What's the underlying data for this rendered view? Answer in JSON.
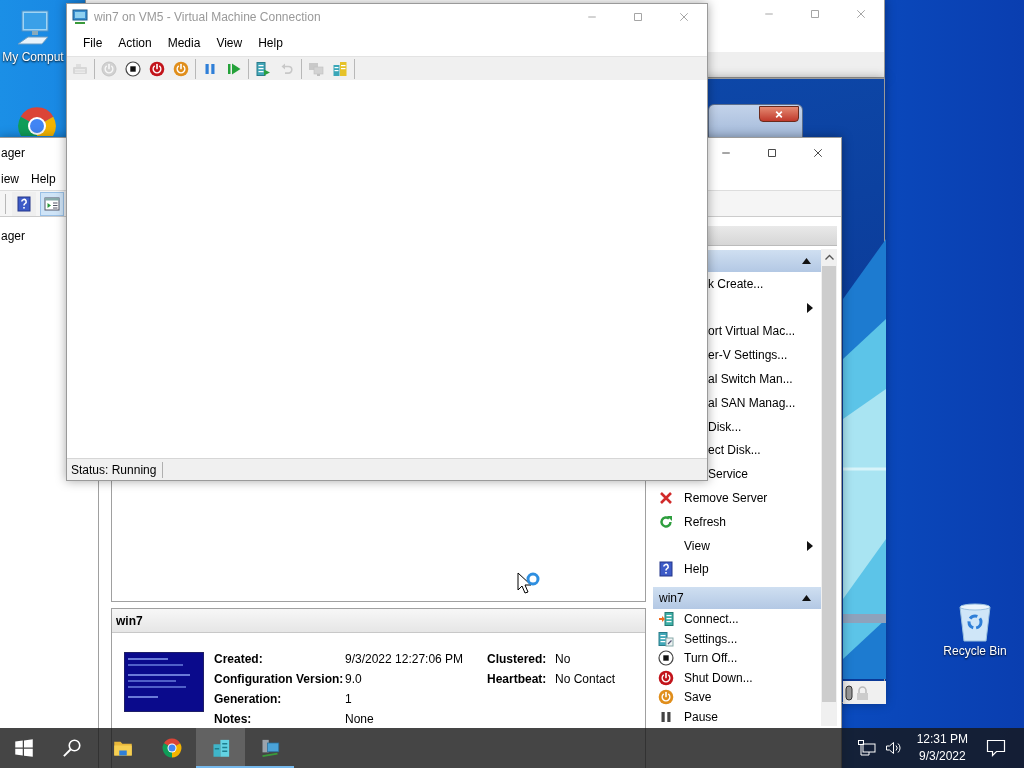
{
  "desktop_icons": [
    {
      "kind": "computer",
      "label": "My Comput"
    },
    {
      "kind": "chrome"
    },
    {
      "kind": "recycle-bin",
      "label": "Recycle Bin"
    }
  ],
  "vm_connection": {
    "title": "win7 on VM5 - Virtual Machine Connection",
    "menu": [
      "File",
      "Action",
      "Media",
      "View",
      "Help"
    ],
    "toolbar": [
      [
        {
          "kind": "ctrl-alt-del",
          "disabled": true
        }
      ],
      [
        {
          "kind": "start",
          "disabled": true
        },
        {
          "kind": "turn-off",
          "disabled": false
        },
        {
          "kind": "shut-down",
          "disabled": false
        },
        {
          "kind": "save",
          "disabled": false
        }
      ],
      [
        {
          "kind": "pause",
          "disabled": false
        },
        {
          "kind": "reset",
          "disabled": false
        }
      ],
      [
        {
          "kind": "checkpoint",
          "disabled": false
        },
        {
          "kind": "revert",
          "disabled": true
        }
      ],
      [
        {
          "kind": "enhanced-session",
          "disabled": true
        },
        {
          "kind": "zoom",
          "disabled": false
        }
      ]
    ],
    "status": "Status: Running"
  },
  "hyperv_manager": {
    "title": "ager",
    "menu": [
      "iew",
      "Help"
    ],
    "toolbar": [
      {
        "kind": "help",
        "on": false
      },
      {
        "kind": "show-pane",
        "on": true
      }
    ],
    "tree": [
      "ager"
    ],
    "details": {
      "title": "win7",
      "fields": [
        {
          "label": "Created:",
          "value": "9/3/2022 12:27:06 PM"
        },
        {
          "label": "Configuration Version:",
          "value": "9.0"
        },
        {
          "label": "Generation:",
          "value": "1"
        },
        {
          "label": "Notes:",
          "value": "None"
        }
      ],
      "fields_right": [
        {
          "label": "Clustered:",
          "value": "No"
        },
        {
          "label": "Heartbeat:",
          "value": "No Contact"
        }
      ]
    },
    "actions": [
      {
        "expanded": true,
        "items": [
          {
            "kind": "clipped",
            "label": "k Create...",
            "submenu": false
          },
          {
            "kind": "clipped",
            "submenu": true
          },
          {
            "kind": "clipped",
            "label": "ort Virtual Mac...",
            "submenu": false
          },
          {
            "kind": "clipped",
            "label": "er-V Settings...",
            "submenu": false
          },
          {
            "kind": "clipped",
            "label": "al Switch Man...",
            "submenu": false
          },
          {
            "kind": "clipped",
            "label": "al SAN Manag...",
            "submenu": false
          },
          {
            "kind": "clipped",
            "label": "Disk...",
            "submenu": false
          },
          {
            "kind": "clipped",
            "label": "ect Disk...",
            "submenu": false
          },
          {
            "kind": "clipped",
            "label": "Service",
            "submenu": false
          },
          {
            "kind": "remove",
            "label": "Remove Server",
            "submenu": false
          },
          {
            "kind": "refresh",
            "label": "Refresh",
            "submenu": false
          },
          {
            "kind": "plain",
            "label": "View",
            "submenu": true
          },
          {
            "kind": "help",
            "label": "Help",
            "submenu": false
          }
        ]
      },
      {
        "title": "win7",
        "expanded": true,
        "items": [
          {
            "kind": "connect",
            "label": "Connect...",
            "submenu": false
          },
          {
            "kind": "settings",
            "label": "Settings...",
            "submenu": false
          },
          {
            "kind": "turn-off",
            "label": "Turn Off...",
            "submenu": false
          },
          {
            "kind": "shut-down",
            "label": "Shut Down...",
            "submenu": false
          },
          {
            "kind": "save",
            "label": "Save",
            "submenu": false
          },
          {
            "kind": "pause",
            "label": "Pause",
            "submenu": false
          }
        ]
      }
    ]
  },
  "taskbar": {
    "apps": [
      {
        "kind": "explorer",
        "running": false,
        "active": false
      },
      {
        "kind": "chrome",
        "running": false,
        "active": false
      },
      {
        "kind": "hyperv-manager",
        "running": true,
        "active": true
      },
      {
        "kind": "vm-connect",
        "running": true,
        "active": false
      }
    ],
    "time": "12:31 PM",
    "date": "9/3/2022"
  }
}
